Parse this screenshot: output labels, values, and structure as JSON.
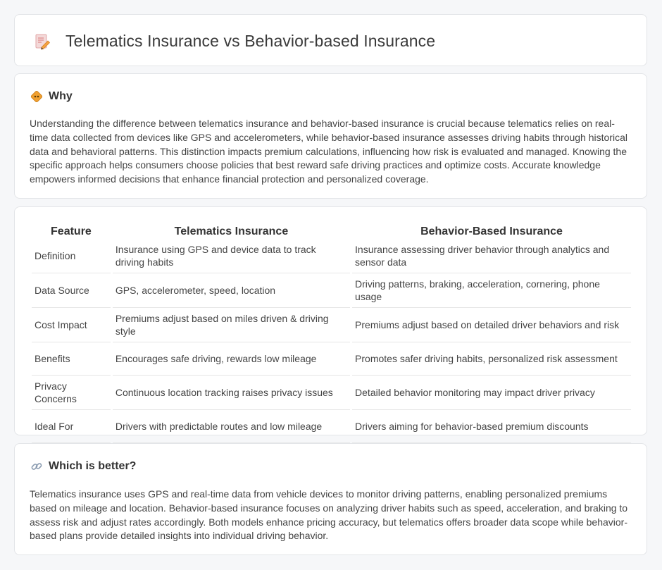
{
  "page": {
    "title": "Telematics Insurance vs Behavior-based Insurance",
    "title_icon": "document-pencil-icon"
  },
  "why": {
    "icon": "diamond-sign-icon",
    "title": "Why",
    "body": "Understanding the difference between telematics insurance and behavior-based insurance is crucial because telematics relies on real-time data collected from devices like GPS and accelerometers, while behavior-based insurance assesses driving habits through historical data and behavioral patterns. This distinction impacts premium calculations, influencing how risk is evaluated and managed. Knowing the specific approach helps consumers choose policies that best reward safe driving practices and optimize costs. Accurate knowledge empowers informed decisions that enhance financial protection and personalized coverage."
  },
  "table": {
    "headers": [
      "Feature",
      "Telematics Insurance",
      "Behavior-Based Insurance"
    ],
    "rows": [
      [
        "Definition",
        "Insurance using GPS and device data to track driving habits",
        "Insurance assessing driver behavior through analytics and sensor data"
      ],
      [
        "Data Source",
        "GPS, accelerometer, speed, location",
        "Driving patterns, braking, acceleration, cornering, phone usage"
      ],
      [
        "Cost Impact",
        "Premiums adjust based on miles driven & driving style",
        "Premiums adjust based on detailed driver behaviors and risk"
      ],
      [
        "Benefits",
        "Encourages safe driving, rewards low mileage",
        "Promotes safer driving habits, personalized risk assessment"
      ],
      [
        "Privacy Concerns",
        "Continuous location tracking raises privacy issues",
        "Detailed behavior monitoring may impact driver privacy"
      ],
      [
        "Ideal For",
        "Drivers with predictable routes and low mileage",
        "Drivers aiming for behavior-based premium discounts"
      ]
    ]
  },
  "better": {
    "icon": "link-icon",
    "title": "Which is better?",
    "body": "Telematics insurance uses GPS and real-time data from vehicle devices to monitor driving patterns, enabling personalized premiums based on mileage and location. Behavior-based insurance focuses on analyzing driver habits such as speed, acceleration, and braking to assess risk and adjust rates accordingly. Both models enhance pricing accuracy, but telematics offers broader data scope while behavior-based plans provide detailed insights into individual driving behavior."
  }
}
